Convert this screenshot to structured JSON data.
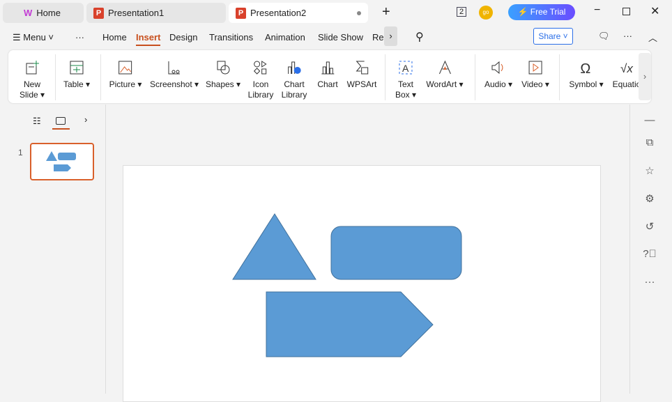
{
  "tabs": [
    {
      "label": "Home"
    },
    {
      "label": "Presentation1"
    },
    {
      "label": "Presentation2"
    }
  ],
  "titlebar": {
    "badge": "2",
    "avatar": "go",
    "free_trial": "Free Trial"
  },
  "menu": {
    "menu_label": "Menu",
    "items": [
      "Home",
      "Insert",
      "Design",
      "Transitions",
      "Animation",
      "Slide Show",
      "Re"
    ],
    "active": "Insert",
    "share": "Share"
  },
  "ribbon": [
    {
      "l1": "New",
      "l2": "Slide ▾"
    },
    {
      "l1": "Table ▾"
    },
    {
      "l1": "Picture ▾"
    },
    {
      "l1": "Screenshot ▾"
    },
    {
      "l1": "Shapes ▾"
    },
    {
      "l1": "Icon",
      "l2": "Library"
    },
    {
      "l1": "Chart",
      "l2": "Library"
    },
    {
      "l1": "Chart"
    },
    {
      "l1": "WPSArt"
    },
    {
      "l1": "Text",
      "l2": "Box ▾"
    },
    {
      "l1": "WordArt ▾"
    },
    {
      "l1": "Audio ▾"
    },
    {
      "l1": "Video ▾"
    },
    {
      "l1": "Symbol ▾"
    },
    {
      "l1": "Equatio"
    }
  ],
  "slides": [
    {
      "number": "1"
    }
  ],
  "colors": {
    "accent": "#c8501e",
    "shape_fill": "#5b9bd5",
    "shape_stroke": "#41719c"
  }
}
